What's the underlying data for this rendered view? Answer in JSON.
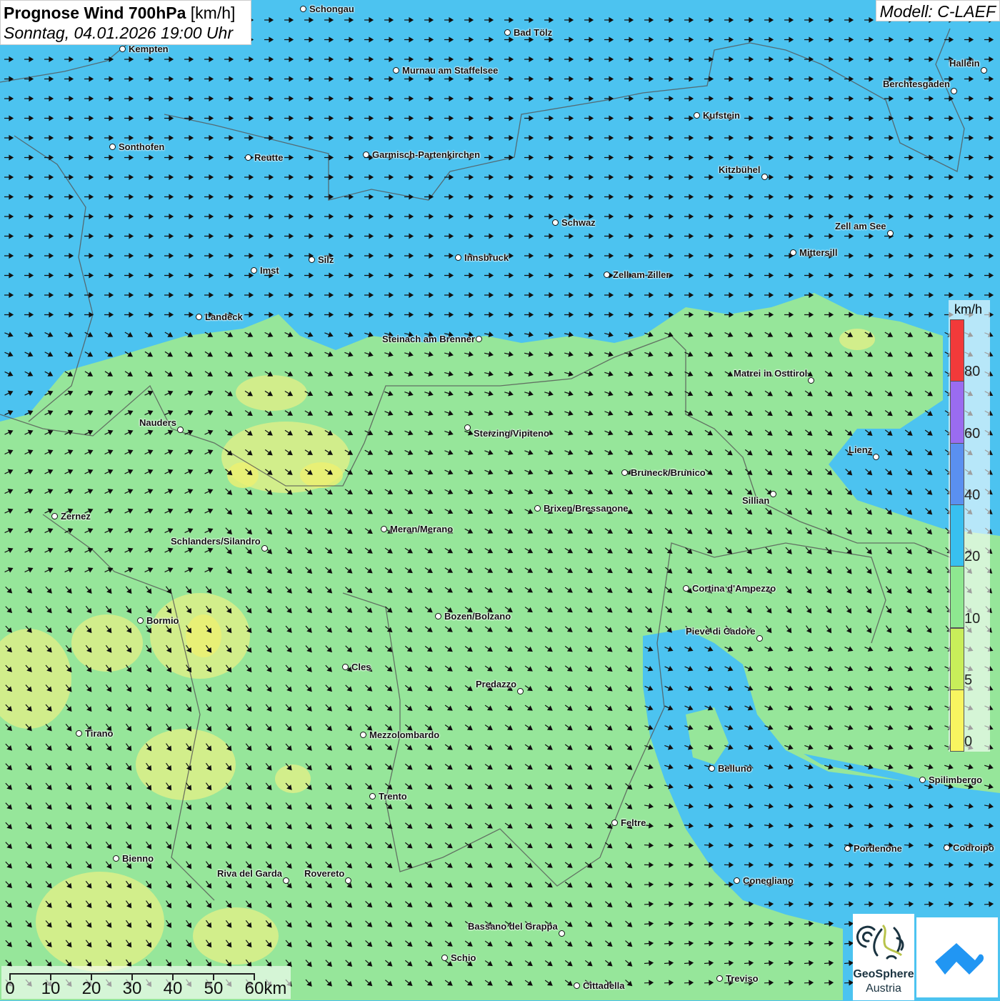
{
  "header": {
    "title_bold": "Prognose Wind 700hPa",
    "title_unit": "[km/h]",
    "subtitle": "Sonntag, 04.01.2026 19:00 Uhr",
    "model": "Modell: C-LAEF"
  },
  "legend": {
    "unit": "km/h",
    "ticks": [
      "80",
      "60",
      "40",
      "20",
      "10",
      "5",
      "0"
    ],
    "colors": [
      "#f23a3a",
      "#9a6cf0",
      "#5a90f0",
      "#38c0f0",
      "#8ee890",
      "#c8ee5a",
      "#f8f560"
    ]
  },
  "scale_bar": {
    "labels": [
      "0",
      "10",
      "20",
      "30",
      "40",
      "50",
      "60km"
    ]
  },
  "logos": {
    "geosphere_line1": "GeoSphere",
    "geosphere_line2": "Austria"
  },
  "cities": [
    "Schongau",
    "Bad Tölz",
    "Kempten",
    "Murnau am Staffelsee",
    "Hallein",
    "Berchtesgaden",
    "Kufstein",
    "Sonthofen",
    "Reutte",
    "Garmisch-Partenkirchen",
    "Kitzbühel",
    "Schwaz",
    "Zell am See",
    "Mittersill",
    "Innsbruck",
    "Silz",
    "Imst",
    "Zell am Ziller",
    "Landeck",
    "Steinach am Brenner",
    "Matrei in Osttirol",
    "Nauders",
    "Sterzing/Vipiteno",
    "Lienz",
    "Bruneck/Brunico",
    "Sillian",
    "Brixen/Bressanone",
    "Zernez",
    "Meran/Merano",
    "Schlanders/Silandro",
    "Cortina d'Ampezzo",
    "Bozen/Bolzano",
    "Bormio",
    "Pieve di Cadore",
    "Cles",
    "Predazzo",
    "Tirano",
    "Mezzolombardo",
    "Belluno",
    "Spilimbergo",
    "Trento",
    "Feltre",
    "Pordenone",
    "Codroipo",
    "Bienno",
    "Riva del Garda",
    "Rovereto",
    "Conegliano",
    "Bassano del Grappa",
    "Schio",
    "Treviso",
    "Cittadella"
  ]
}
